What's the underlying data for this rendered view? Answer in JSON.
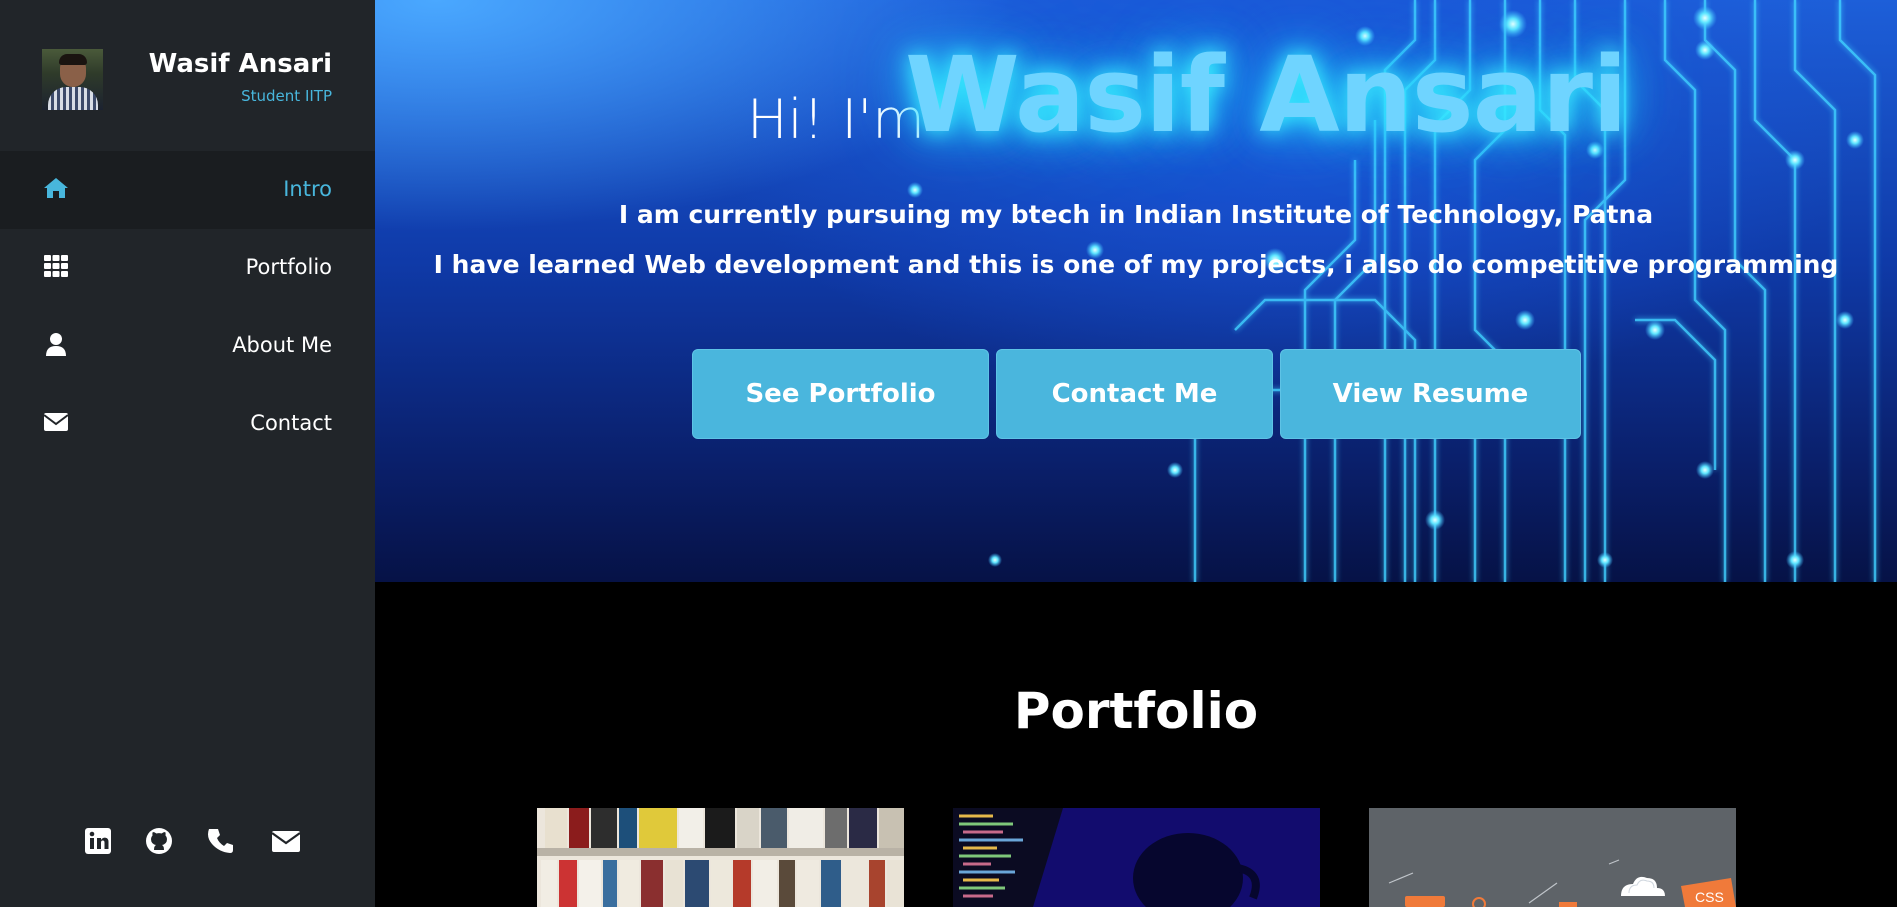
{
  "sidebar": {
    "name": "Wasif Ansari",
    "role": "Student IITP",
    "nav": [
      {
        "label": "Intro",
        "icon": "home-icon",
        "active": true
      },
      {
        "label": "Portfolio",
        "icon": "grid-icon",
        "active": false
      },
      {
        "label": "About Me",
        "icon": "user-icon",
        "active": false
      },
      {
        "label": "Contact",
        "icon": "envelope-icon",
        "active": false
      }
    ],
    "socials": [
      "linkedin-icon",
      "github-icon",
      "phone-icon",
      "email-icon"
    ]
  },
  "hero": {
    "greeting": "Hi! I'm",
    "name": "Wasif Ansari",
    "line1": "I am currently pursuing my btech in Indian Institute of Technology, Patna",
    "line2": "I have learned Web development and this is one of my projects, i also do competitive programming",
    "buttons": [
      "See Portfolio",
      "Contact Me",
      "View Resume"
    ]
  },
  "portfolio": {
    "title": "Portfolio",
    "card3_badge": "CSS"
  },
  "colors": {
    "accent": "#48b6dc",
    "sidebar_bg": "#212529",
    "button_bg": "#4ab6dd"
  }
}
